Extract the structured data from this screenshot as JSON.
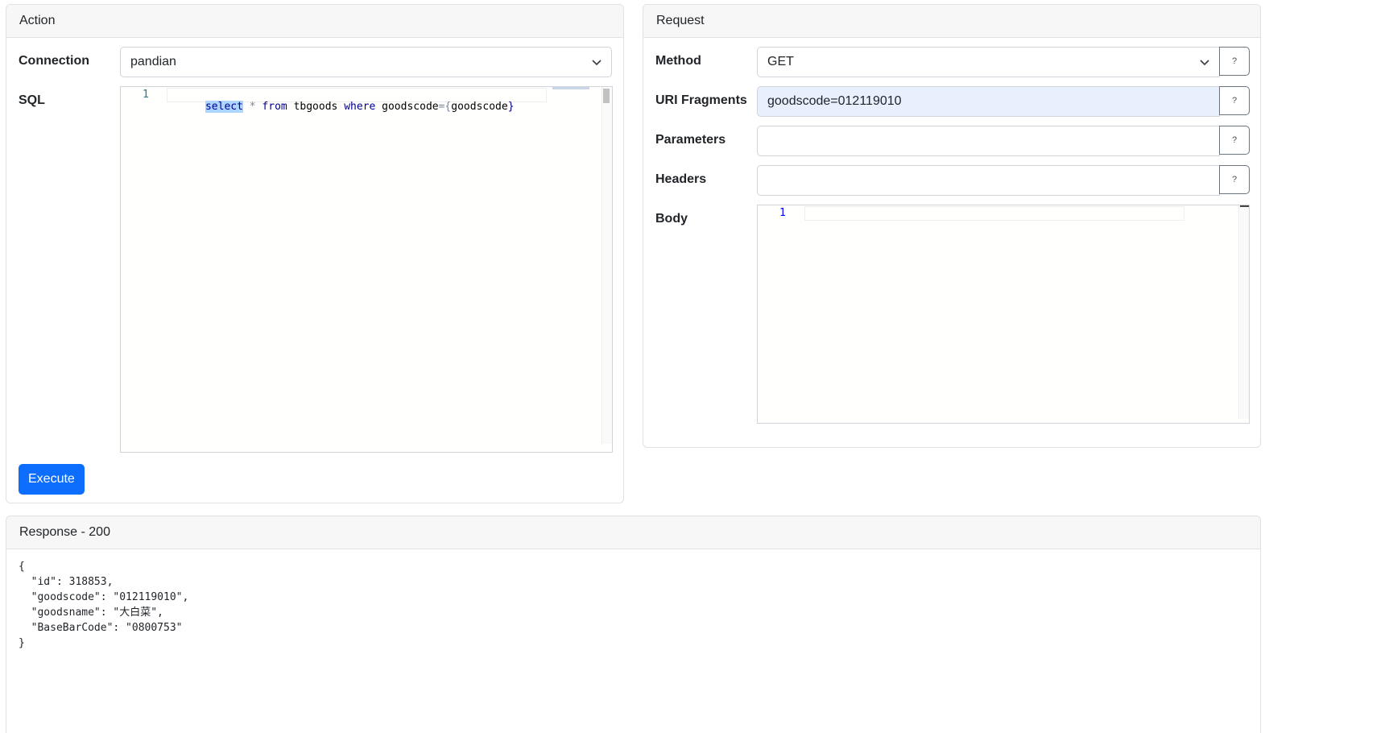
{
  "action": {
    "header": "Action",
    "connection_label": "Connection",
    "connection_value": "pandian",
    "sql_label": "SQL",
    "sql_line_number": "1",
    "sql_tokens": {
      "select": "select",
      "star": "*",
      "from": "from",
      "table": "tbgoods",
      "where": "where",
      "column": "goodscode",
      "eq_brace": "={",
      "param": "goodscode",
      "close_brace": "}"
    },
    "execute_label": "Execute"
  },
  "request": {
    "header": "Request",
    "method_label": "Method",
    "method_value": "GET",
    "uri_label": "URI Fragments",
    "uri_value": "goodscode=012119010",
    "params_label": "Parameters",
    "params_value": "",
    "headers_label": "Headers",
    "headers_value": "",
    "body_label": "Body",
    "body_line_number": "1",
    "help_label": "?"
  },
  "response": {
    "header": "Response - 200",
    "body": "{\n  \"id\": 318853,\n  \"goodscode\": \"012119010\",\n  \"goodsname\": \"大白菜\",\n  \"BaseBarCode\": \"0800753\"\n}"
  },
  "colors": {
    "primary": "#0d6efd",
    "uri_field_bg": "#e8f0fe",
    "keyword": "#0000ff"
  }
}
